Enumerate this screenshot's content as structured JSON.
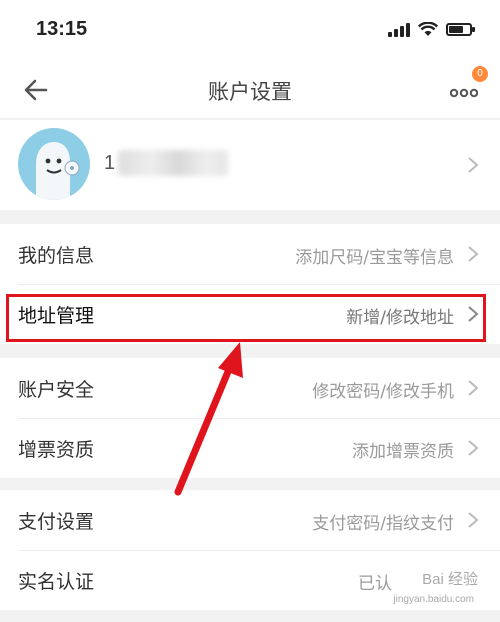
{
  "status_bar": {
    "time": "13:15"
  },
  "nav": {
    "title": "账户设置",
    "badge": "0"
  },
  "profile": {
    "name": "1"
  },
  "groups": [
    {
      "items": [
        {
          "label": "我的信息",
          "value": "添加尺码/宝宝等信息"
        },
        {
          "label": "地址管理",
          "value": "新增/修改地址"
        }
      ]
    },
    {
      "items": [
        {
          "label": "账户安全",
          "value": "修改密码/修改手机"
        },
        {
          "label": "增票资质",
          "value": "添加增票资质"
        }
      ]
    },
    {
      "items": [
        {
          "label": "支付设置",
          "value": "支付密码/指纹支付"
        },
        {
          "label": "实名认证",
          "value": "已认"
        }
      ]
    }
  ],
  "watermark": {
    "text": "Bai 经验",
    "sub": "jingyan.baidu.com"
  },
  "colors": {
    "highlight": "#e0141c",
    "badge": "#ff8a3c",
    "avatar": "#8ecde6"
  }
}
